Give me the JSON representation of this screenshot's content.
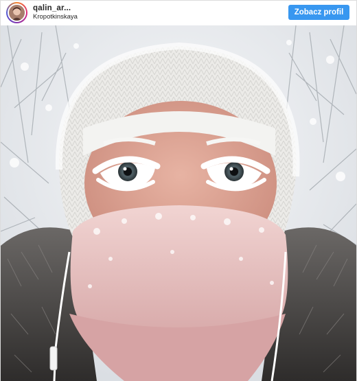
{
  "post": {
    "username": "qalin_ar...",
    "location": "Kropotkinskaya",
    "profile_button_label": "Zobacz profil",
    "avatar_icon": "user-avatar-icon"
  },
  "photo": {
    "subject": "frosted-face-selfie-image"
  },
  "colors": {
    "button": "#3897f0",
    "text": "#262626"
  }
}
